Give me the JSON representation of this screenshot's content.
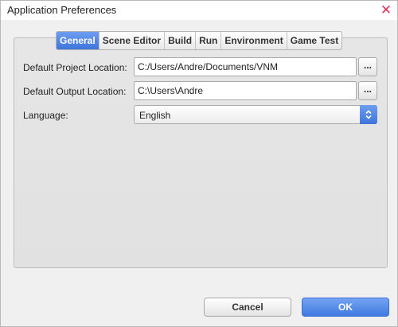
{
  "window": {
    "title": "Application Preferences",
    "close_symbol": "✕"
  },
  "tabs": [
    {
      "label": "General",
      "active": true
    },
    {
      "label": "Scene Editor",
      "active": false
    },
    {
      "label": "Build",
      "active": false
    },
    {
      "label": "Run",
      "active": false
    },
    {
      "label": "Environment",
      "active": false
    },
    {
      "label": "Game Test",
      "active": false
    }
  ],
  "fields": {
    "project_location": {
      "label": "Default Project Location:",
      "value": "C:/Users/Andre/Documents/VNM",
      "browse_label": "..."
    },
    "output_location": {
      "label": "Default Output Location:",
      "value": "C:\\Users\\Andre",
      "browse_label": "..."
    },
    "language": {
      "label": "Language:",
      "value": "English"
    }
  },
  "buttons": {
    "cancel": "Cancel",
    "ok": "OK"
  },
  "colors": {
    "accent": "#4a7fe3",
    "close": "#e0365b"
  },
  "icons": {
    "close": "close-icon",
    "select": "updown-arrows-icon"
  }
}
